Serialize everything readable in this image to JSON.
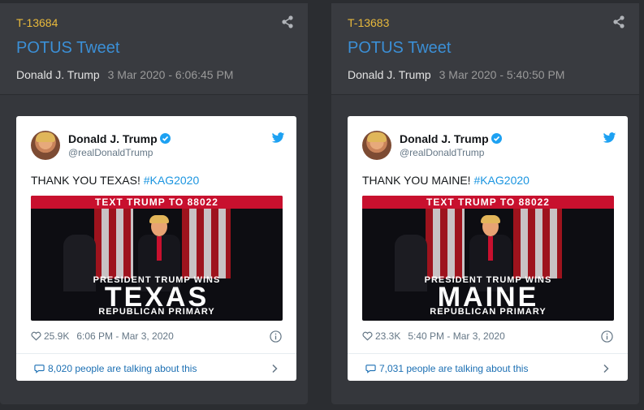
{
  "cards": [
    {
      "id": "T-13684",
      "title": "POTUS Tweet",
      "author": "Donald J. Trump",
      "timestamp": "3 Mar 2020 - 6:06:45 PM",
      "tweet": {
        "name": "Donald J. Trump",
        "handle": "@realDonaldTrump",
        "text": "THANK YOU TEXAS! ",
        "hashtag": "#KAG2020",
        "image": {
          "banner_prefix": "TEXT ",
          "banner_bold": "TRUMP",
          "banner_suffix": " TO 88022",
          "line1": "PRESIDENT TRUMP WINS",
          "state": "TEXAS",
          "line3": "REPUBLICAN PRIMARY"
        },
        "likes": "25.9K",
        "time": "6:06 PM - Mar 3, 2020",
        "talking": "8,020 people are talking about this"
      }
    },
    {
      "id": "T-13683",
      "title": "POTUS Tweet",
      "author": "Donald J. Trump",
      "timestamp": "3 Mar 2020 - 5:40:50 PM",
      "tweet": {
        "name": "Donald J. Trump",
        "handle": "@realDonaldTrump",
        "text": "THANK YOU MAINE! ",
        "hashtag": "#KAG2020",
        "image": {
          "banner_prefix": "TEXT ",
          "banner_bold": "TRUMP",
          "banner_suffix": " TO 88022",
          "line1": "PRESIDENT TRUMP WINS",
          "state": "MAINE",
          "line3": "REPUBLICAN PRIMARY"
        },
        "likes": "23.3K",
        "time": "5:40 PM - Mar 3, 2020",
        "talking": "7,031 people are talking about this"
      }
    }
  ],
  "icons": {
    "share": "share-icon",
    "verified": "verified-badge-icon",
    "twitter": "twitter-bird-icon",
    "like": "heart-icon",
    "info": "info-icon",
    "reply": "speech-bubble-icon",
    "chevron": "chevron-right-icon"
  },
  "colors": {
    "id": "#e8b93c",
    "title": "#3b8fd6",
    "twitter_blue": "#1da1f2",
    "banner_red": "#c8102e"
  }
}
